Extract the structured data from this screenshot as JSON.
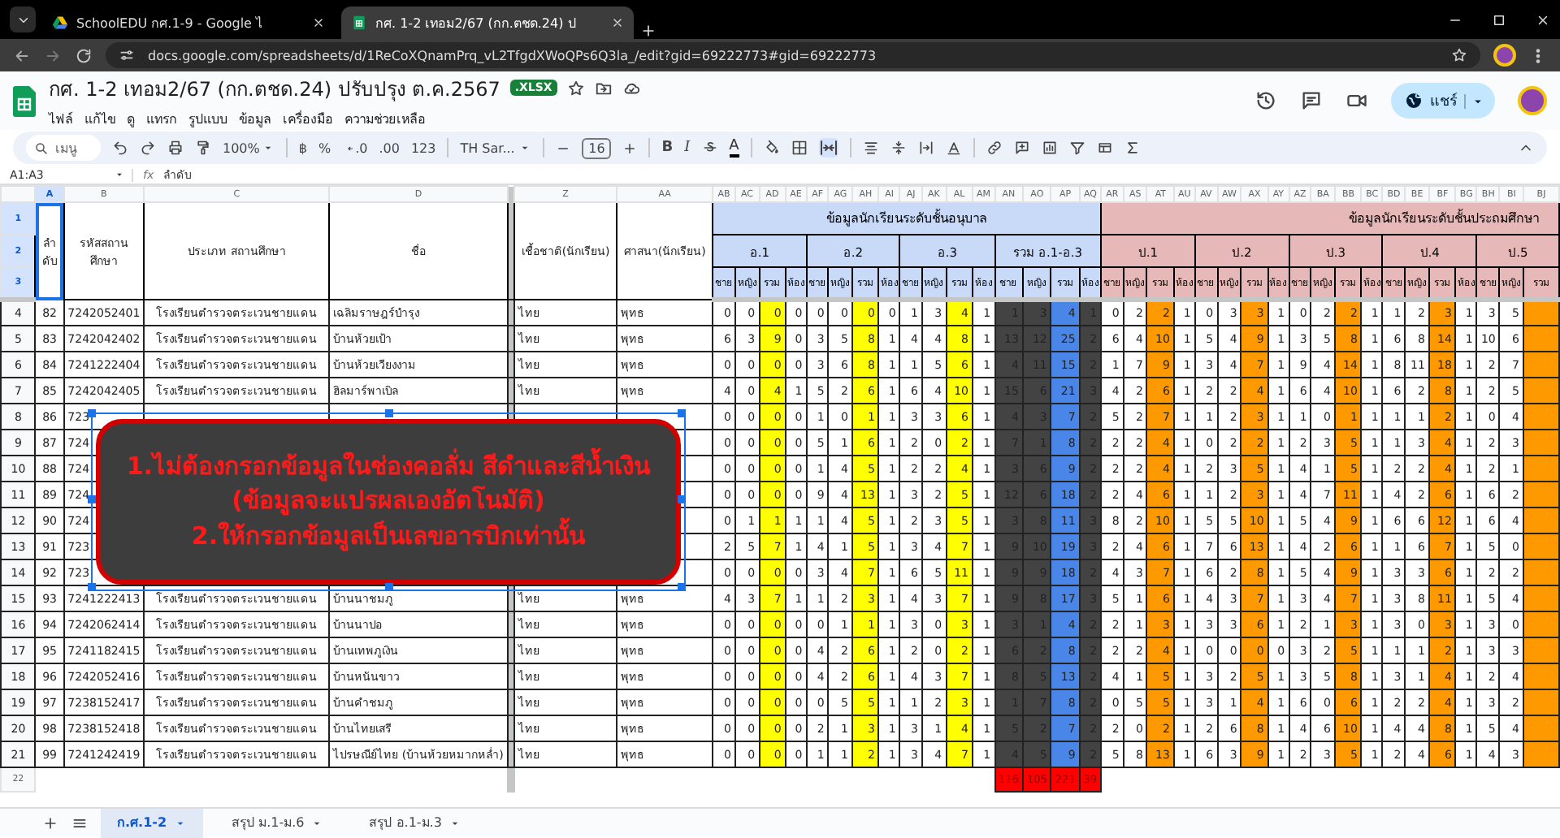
{
  "browser": {
    "tabs": [
      {
        "title": "SchoolEDU กศ.1-9 - Google ไ",
        "selected": false
      },
      {
        "title": "กศ. 1-2 เทอม2/67 (กก.ตชด.24) ป",
        "selected": true
      }
    ],
    "url": "docs.google.com/spreadsheets/d/1ReCoXQnamPrq_vL2TfgdXWoQPs6Q3la_/edit?gid=69222773#gid=69222773"
  },
  "document": {
    "title": "กศ. 1-2 เทอม2/67 (กก.ตชด.24) ปรับปรุง ต.ค.2567",
    "badge": ".XLSX",
    "menus": [
      "ไฟล์",
      "แก้ไข",
      "ดู",
      "แทรก",
      "รูปแบบ",
      "ข้อมูล",
      "เครื่องมือ",
      "ความช่วยเหลือ"
    ],
    "share": "แชร์"
  },
  "toolbar": {
    "search_placeholder": "เมนู",
    "zoom": "100%",
    "currency": "฿",
    "percent": "%",
    "decimal_less": ".0",
    "decimal_more": ".00",
    "number_format": "123",
    "font": "TH Sar...",
    "font_size": "16",
    "bold": "B",
    "italic": "I",
    "text_color": "A"
  },
  "formula_bar": {
    "cell_ref": "A1:A3",
    "fx": "fx",
    "content": "ลำดับ"
  },
  "sheet": {
    "columns": [
      {
        "letter": "A",
        "selected": true
      },
      {
        "letter": "B",
        "selected": false
      },
      {
        "letter": "C",
        "selected": false
      },
      {
        "letter": "D",
        "selected": false
      },
      {
        "letter": "Z",
        "selected": false
      },
      {
        "letter": "AA",
        "selected": false
      },
      {
        "letter": "AB",
        "selected": false
      },
      {
        "letter": "AC",
        "selected": false
      },
      {
        "letter": "AD",
        "selected": false,
        "color": "#ffff00"
      },
      {
        "letter": "AE",
        "selected": false
      },
      {
        "letter": "AF",
        "selected": false
      },
      {
        "letter": "AG",
        "selected": false
      },
      {
        "letter": "AH",
        "selected": false,
        "color": "#ffff00"
      },
      {
        "letter": "AI",
        "selected": false
      },
      {
        "letter": "AJ",
        "selected": false
      },
      {
        "letter": "AK",
        "selected": false
      },
      {
        "letter": "AL",
        "selected": false,
        "color": "#ffff00"
      },
      {
        "letter": "AM",
        "selected": false
      },
      {
        "letter": "AN",
        "selected": false,
        "color": "#434343"
      },
      {
        "letter": "AO",
        "selected": false,
        "color": "#434343"
      },
      {
        "letter": "AP",
        "selected": false,
        "color": "#4a86e8"
      },
      {
        "letter": "AQ",
        "selected": false,
        "color": "#434343"
      },
      {
        "letter": "AR",
        "selected": false
      },
      {
        "letter": "AS",
        "selected": false
      },
      {
        "letter": "AT",
        "selected": false,
        "color": "#ff9900"
      },
      {
        "letter": "AU",
        "selected": false
      },
      {
        "letter": "AV",
        "selected": false
      },
      {
        "letter": "AW",
        "selected": false
      },
      {
        "letter": "AX",
        "selected": false,
        "color": "#ff9900"
      },
      {
        "letter": "AY",
        "selected": false
      },
      {
        "letter": "AZ",
        "selected": false
      },
      {
        "letter": "BA",
        "selected": false
      },
      {
        "letter": "BB",
        "selected": false,
        "color": "#ff9900"
      },
      {
        "letter": "BC",
        "selected": false
      },
      {
        "letter": "BD",
        "selected": false
      },
      {
        "letter": "BE",
        "selected": false
      },
      {
        "letter": "BF",
        "selected": false,
        "color": "#ff9900"
      },
      {
        "letter": "BG",
        "selected": false
      },
      {
        "letter": "BH",
        "selected": false
      },
      {
        "letter": "BI",
        "selected": false
      },
      {
        "letter": "BJ",
        "selected": false,
        "color": "#ff9900"
      }
    ],
    "header_rows": [
      {
        "row": "1",
        "selected": true
      },
      {
        "row": "2",
        "selected": true
      },
      {
        "row": "3",
        "selected": true
      }
    ],
    "fixed_headers": [
      "ลำดับ",
      "รหัสสถานศึกษา",
      "ประเภท สถานศึกษา",
      "ชื่อ",
      "เชื้อชาติ(นักเรียน)",
      "ศาสนา(นักเรียน)"
    ],
    "sections": [
      {
        "title": "ข้อมูลนักเรียนระดับชั้นอนุบาล",
        "color": "#c9daf8",
        "groups": [
          {
            "label": "อ.1",
            "subs": [
              "ชาย",
              "หญิง",
              "รวม",
              "ห้อง"
            ]
          },
          {
            "label": "อ.2",
            "subs": [
              "ชาย",
              "หญิง",
              "รวม",
              "ห้อง"
            ]
          },
          {
            "label": "อ.3",
            "subs": [
              "ชาย",
              "หญิง",
              "รวม",
              "ห้อง"
            ]
          },
          {
            "label": "รวม อ.1-อ.3",
            "subs": [
              "ชาย",
              "หญิง",
              "รวม",
              "ห้อง"
            ]
          }
        ]
      },
      {
        "title": "ข้อมูลนักเรียนระดับชั้นประถมศึกษา",
        "color": "#e6b8b7",
        "groups": [
          {
            "label": "ป.1",
            "subs": [
              "ชาย",
              "หญิง",
              "รวม",
              "ห้อง"
            ]
          },
          {
            "label": "ป.2",
            "subs": [
              "ชาย",
              "หญิง",
              "รวม",
              "ห้อง"
            ]
          },
          {
            "label": "ป.3",
            "subs": [
              "ชาย",
              "หญิง",
              "รวม",
              "ห้อง"
            ]
          },
          {
            "label": "ป.4",
            "subs": [
              "ชาย",
              "หญิง",
              "รวม",
              "ห้อง"
            ]
          },
          {
            "label": "ป.5",
            "subs": [
              "ชาย",
              "หญิง",
              "รวม"
            ]
          }
        ]
      }
    ],
    "rows": [
      {
        "row": "4",
        "no": "82",
        "code": "7242052401",
        "type": "โรงเรียนตำรวจตระเวนชายแดน",
        "name": "เฉลิมราษฎร์บำรุง",
        "ethnicity": "ไทย",
        "religion": "พุทธ",
        "values": [
          "0",
          "0",
          "0",
          "0",
          "0",
          "0",
          "0",
          "0",
          "1",
          "3",
          "4",
          "1",
          "1",
          "3",
          "4",
          "1",
          "0",
          "2",
          "2",
          "1",
          "0",
          "3",
          "3",
          "1",
          "0",
          "2",
          "2",
          "1",
          "1",
          "2",
          "3",
          "1",
          "3",
          "5"
        ]
      },
      {
        "row": "5",
        "no": "83",
        "code": "7242042402",
        "type": "โรงเรียนตำรวจตระเวนชายแดน",
        "name": "บ้านห้วยเป้า",
        "ethnicity": "ไทย",
        "religion": "พุทธ",
        "values": [
          "6",
          "3",
          "9",
          "0",
          "3",
          "5",
          "8",
          "1",
          "4",
          "4",
          "8",
          "1",
          "13",
          "12",
          "25",
          "2",
          "6",
          "4",
          "10",
          "1",
          "5",
          "4",
          "9",
          "1",
          "3",
          "5",
          "8",
          "1",
          "6",
          "8",
          "14",
          "1",
          "10",
          "6"
        ]
      },
      {
        "row": "6",
        "no": "84",
        "code": "7241222404",
        "type": "โรงเรียนตำรวจตระเวนชายแดน",
        "name": "บ้านห้วยเวียงงาม",
        "ethnicity": "ไทย",
        "religion": "พุทธ",
        "values": [
          "0",
          "0",
          "0",
          "0",
          "3",
          "6",
          "8",
          "1",
          "1",
          "5",
          "6",
          "1",
          "4",
          "11",
          "15",
          "2",
          "1",
          "7",
          "9",
          "1",
          "3",
          "4",
          "7",
          "1",
          "9",
          "4",
          "14",
          "1",
          "8",
          "11",
          "18",
          "1",
          "2",
          "7"
        ]
      },
      {
        "row": "7",
        "no": "85",
        "code": "7242042405",
        "type": "โรงเรียนตำรวจตระเวนชายแดน",
        "name": "ฮิลมาร์พาเบิล",
        "ethnicity": "ไทย",
        "religion": "พุทธ",
        "values": [
          "4",
          "0",
          "4",
          "1",
          "5",
          "2",
          "6",
          "1",
          "6",
          "4",
          "10",
          "1",
          "15",
          "6",
          "21",
          "3",
          "4",
          "2",
          "6",
          "1",
          "2",
          "2",
          "4",
          "1",
          "6",
          "4",
          "10",
          "1",
          "6",
          "2",
          "8",
          "1",
          "2",
          "5"
        ]
      },
      {
        "row": "8",
        "no": "86",
        "code": "723",
        "values": [
          "0",
          "0",
          "0",
          "0",
          "1",
          "0",
          "1",
          "1",
          "3",
          "3",
          "6",
          "1",
          "4",
          "3",
          "7",
          "2",
          "5",
          "2",
          "7",
          "1",
          "1",
          "2",
          "3",
          "1",
          "1",
          "0",
          "1",
          "1",
          "1",
          "1",
          "2",
          "1",
          "0",
          "4"
        ]
      },
      {
        "row": "9",
        "no": "87",
        "code": "724",
        "values": [
          "0",
          "0",
          "0",
          "0",
          "5",
          "1",
          "6",
          "1",
          "2",
          "0",
          "2",
          "1",
          "7",
          "1",
          "8",
          "2",
          "2",
          "2",
          "4",
          "1",
          "0",
          "2",
          "2",
          "1",
          "2",
          "3",
          "5",
          "1",
          "1",
          "3",
          "4",
          "1",
          "2",
          "3"
        ]
      },
      {
        "row": "10",
        "no": "88",
        "code": "724",
        "values": [
          "0",
          "0",
          "0",
          "0",
          "1",
          "4",
          "5",
          "1",
          "2",
          "2",
          "4",
          "1",
          "3",
          "6",
          "9",
          "2",
          "2",
          "2",
          "4",
          "1",
          "2",
          "3",
          "5",
          "1",
          "4",
          "1",
          "5",
          "1",
          "2",
          "2",
          "4",
          "1",
          "2",
          "1"
        ]
      },
      {
        "row": "11",
        "no": "89",
        "code": "724",
        "values": [
          "0",
          "0",
          "0",
          "0",
          "9",
          "4",
          "13",
          "1",
          "3",
          "2",
          "5",
          "1",
          "12",
          "6",
          "18",
          "2",
          "2",
          "4",
          "6",
          "1",
          "1",
          "2",
          "3",
          "1",
          "4",
          "7",
          "11",
          "1",
          "4",
          "2",
          "6",
          "1",
          "6",
          "2"
        ]
      },
      {
        "row": "12",
        "no": "90",
        "code": "724",
        "values": [
          "0",
          "1",
          "1",
          "1",
          "1",
          "4",
          "5",
          "1",
          "2",
          "3",
          "5",
          "1",
          "3",
          "8",
          "11",
          "3",
          "8",
          "2",
          "10",
          "1",
          "5",
          "5",
          "10",
          "1",
          "5",
          "4",
          "9",
          "1",
          "6",
          "6",
          "12",
          "1",
          "6",
          "4"
        ]
      },
      {
        "row": "13",
        "no": "91",
        "code": "723",
        "values": [
          "2",
          "5",
          "7",
          "1",
          "4",
          "1",
          "5",
          "1",
          "3",
          "4",
          "7",
          "1",
          "9",
          "10",
          "19",
          "3",
          "2",
          "4",
          "6",
          "1",
          "7",
          "6",
          "13",
          "1",
          "4",
          "2",
          "6",
          "1",
          "1",
          "6",
          "7",
          "1",
          "5",
          "0"
        ]
      },
      {
        "row": "14",
        "no": "92",
        "code": "723",
        "values": [
          "0",
          "0",
          "0",
          "0",
          "3",
          "4",
          "7",
          "1",
          "6",
          "5",
          "11",
          "1",
          "9",
          "9",
          "18",
          "2",
          "4",
          "3",
          "7",
          "1",
          "6",
          "2",
          "8",
          "1",
          "5",
          "4",
          "9",
          "1",
          "3",
          "3",
          "6",
          "1",
          "2",
          "2"
        ]
      },
      {
        "row": "15",
        "no": "93",
        "code": "7241222413",
        "type": "โรงเรียนตำรวจตระเวนชายแดน",
        "name": "บ้านนาชมภู",
        "ethnicity": "ไทย",
        "religion": "พุทธ",
        "values": [
          "4",
          "3",
          "7",
          "1",
          "1",
          "2",
          "3",
          "1",
          "4",
          "3",
          "7",
          "1",
          "9",
          "8",
          "17",
          "3",
          "5",
          "1",
          "6",
          "1",
          "4",
          "3",
          "7",
          "1",
          "3",
          "4",
          "7",
          "1",
          "3",
          "8",
          "11",
          "1",
          "5",
          "4"
        ]
      },
      {
        "row": "16",
        "no": "94",
        "code": "7242062414",
        "type": "โรงเรียนตำรวจตระเวนชายแดน",
        "name": "บ้านนาปอ",
        "ethnicity": "ไทย",
        "religion": "พุทธ",
        "values": [
          "0",
          "0",
          "0",
          "0",
          "0",
          "1",
          "1",
          "1",
          "3",
          "0",
          "3",
          "1",
          "3",
          "1",
          "4",
          "2",
          "2",
          "1",
          "3",
          "1",
          "3",
          "3",
          "6",
          "1",
          "2",
          "1",
          "3",
          "1",
          "3",
          "0",
          "3",
          "1",
          "3",
          "0"
        ]
      },
      {
        "row": "17",
        "no": "95",
        "code": "7241182415",
        "type": "โรงเรียนตำรวจตระเวนชายแดน",
        "name": "บ้านเทพภูเงิน",
        "ethnicity": "ไทย",
        "religion": "พุทธ",
        "values": [
          "0",
          "0",
          "0",
          "0",
          "4",
          "2",
          "6",
          "1",
          "2",
          "0",
          "2",
          "1",
          "6",
          "2",
          "8",
          "2",
          "2",
          "2",
          "4",
          "1",
          "0",
          "0",
          "0",
          "0",
          "3",
          "2",
          "5",
          "1",
          "1",
          "1",
          "2",
          "1",
          "3",
          "3"
        ]
      },
      {
        "row": "18",
        "no": "96",
        "code": "7242052416",
        "type": "โรงเรียนตำรวจตระเวนชายแดน",
        "name": "บ้านหนันขาว",
        "ethnicity": "ไทย",
        "religion": "พุทธ",
        "values": [
          "0",
          "0",
          "0",
          "0",
          "4",
          "2",
          "6",
          "1",
          "4",
          "3",
          "7",
          "1",
          "8",
          "5",
          "13",
          "2",
          "4",
          "1",
          "5",
          "1",
          "3",
          "2",
          "5",
          "1",
          "3",
          "5",
          "8",
          "1",
          "3",
          "1",
          "4",
          "1",
          "2",
          "4"
        ]
      },
      {
        "row": "19",
        "no": "97",
        "code": "7238152417",
        "type": "โรงเรียนตำรวจตระเวนชายแดน",
        "name": "บ้านคำชมภู",
        "ethnicity": "ไทย",
        "religion": "พุทธ",
        "values": [
          "0",
          "0",
          "0",
          "0",
          "0",
          "5",
          "5",
          "1",
          "1",
          "2",
          "3",
          "1",
          "1",
          "7",
          "8",
          "2",
          "0",
          "5",
          "5",
          "1",
          "3",
          "1",
          "4",
          "1",
          "6",
          "0",
          "6",
          "1",
          "2",
          "2",
          "4",
          "1",
          "3",
          "2"
        ]
      },
      {
        "row": "20",
        "no": "98",
        "code": "7238152418",
        "type": "โรงเรียนตำรวจตระเวนชายแดน",
        "name": "บ้านไทยเสรี",
        "ethnicity": "ไทย",
        "religion": "พุทธ",
        "values": [
          "0",
          "0",
          "0",
          "0",
          "2",
          "1",
          "3",
          "1",
          "3",
          "1",
          "4",
          "1",
          "5",
          "2",
          "7",
          "2",
          "2",
          "0",
          "2",
          "1",
          "2",
          "6",
          "8",
          "1",
          "4",
          "6",
          "10",
          "1",
          "4",
          "4",
          "8",
          "1",
          "5",
          "4"
        ]
      },
      {
        "row": "21",
        "no": "99",
        "code": "7241242419",
        "type": "โรงเรียนตำรวจตระเวนชายแดน",
        "name": "ไปรษณีย์ไทย (บ้านห้วยหมากหล่ำ)",
        "ethnicity": "ไทย",
        "religion": "พุทธ",
        "values": [
          "0",
          "0",
          "0",
          "0",
          "1",
          "1",
          "2",
          "1",
          "3",
          "4",
          "7",
          "1",
          "4",
          "5",
          "9",
          "2",
          "5",
          "8",
          "13",
          "1",
          "6",
          "3",
          "9",
          "1",
          "2",
          "3",
          "5",
          "1",
          "2",
          "4",
          "6",
          "1",
          "4",
          "3"
        ]
      }
    ],
    "totals": {
      "row": "22",
      "values": [
        "116",
        "105",
        "221",
        "39"
      ]
    },
    "note": [
      "1.ไม่ต้องกรอกข้อมูลในช่องคอลั่ม สีดำและสีน้ำเงิน",
      "(ข้อมูลจะแปรผลเองอัตโนมัติ)",
      "2.ให้กรอกข้อมูลเป็นเลขอารบิกเท่านั้น"
    ]
  },
  "sheet_tabs": [
    {
      "label": "ก.ศ.1-2",
      "selected": true
    },
    {
      "label": "สรุป ม.1-ม.6",
      "selected": false
    },
    {
      "label": "สรุป อ.1-ม.3",
      "selected": false
    }
  ]
}
